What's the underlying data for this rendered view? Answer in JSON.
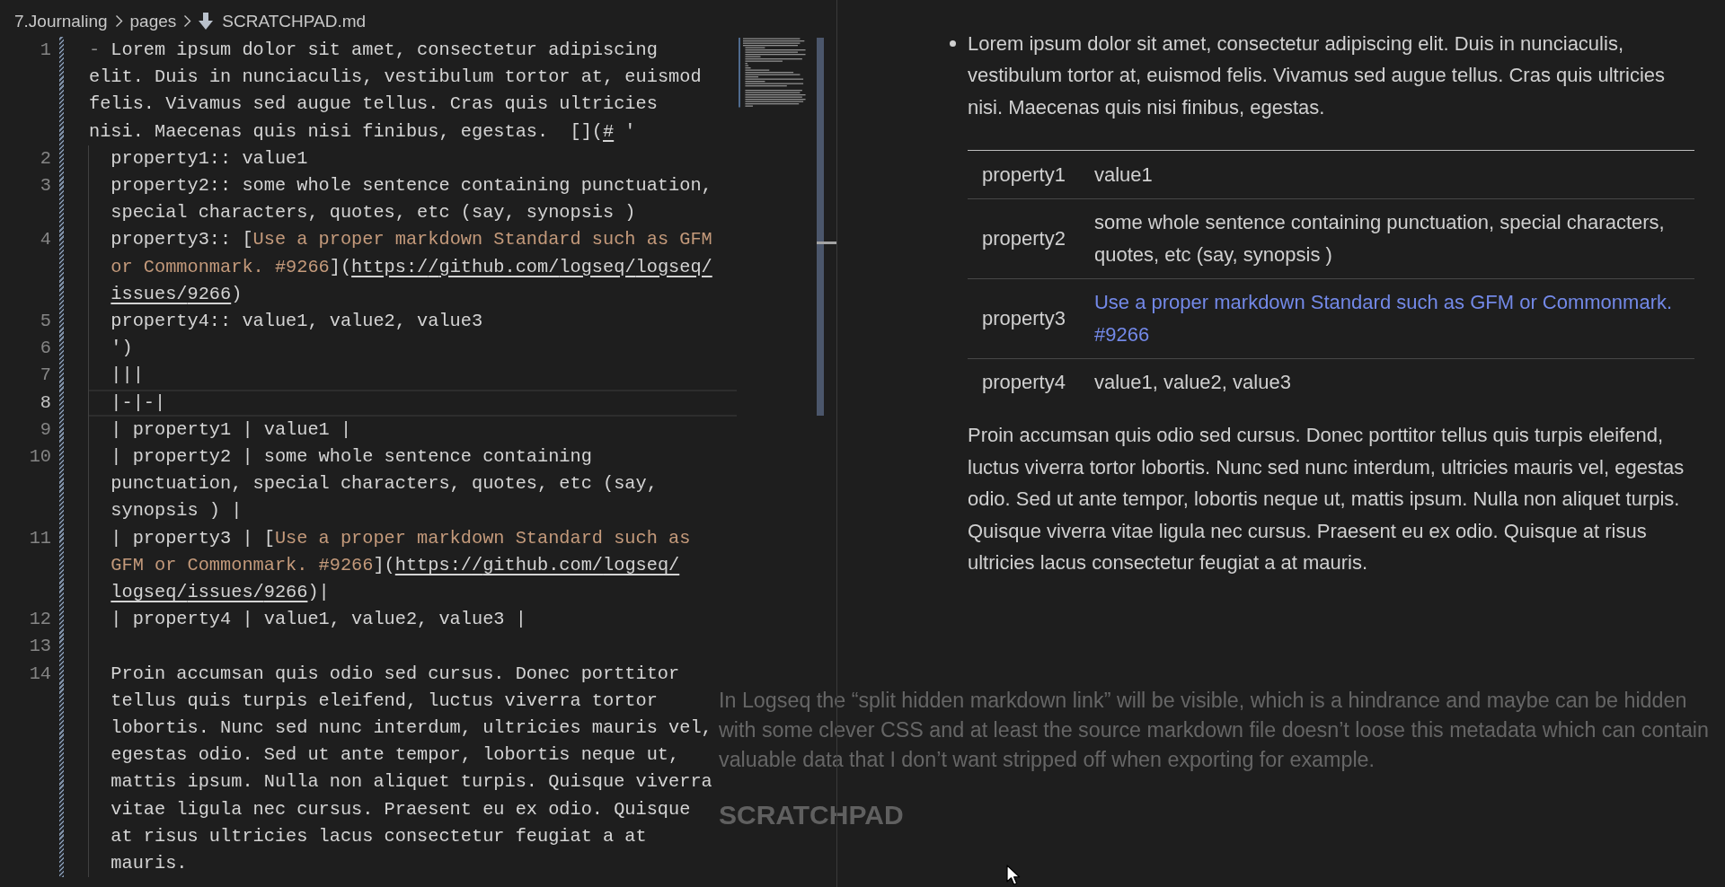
{
  "breadcrumb": [
    {
      "label": "7.Journaling",
      "kind": "folder"
    },
    {
      "label": "pages",
      "kind": "folder"
    },
    {
      "label": "SCRATCHPAD.md",
      "kind": "file"
    }
  ],
  "editor": {
    "lines": [
      {
        "number": "1",
        "indented": false,
        "cursor_line": false,
        "segments": [
          {
            "kind": "marker",
            "text": "-"
          },
          {
            "kind": "text",
            "text": " Lorem ipsum dolor sit amet, consectetur adipiscing elit. Duis in nunciaculis, vestibulum tortor at, euismod felis. Vivamus sed augue tellus. Cras quis ultricies nisi. Maecenas quis nisi finibus, egestas.  []("
          },
          {
            "kind": "url",
            "text": "#"
          },
          {
            "kind": "text",
            "text": " '"
          }
        ]
      },
      {
        "number": "2",
        "indented": true,
        "cursor_line": false,
        "segments": [
          {
            "kind": "text",
            "text": "property1:: value1"
          }
        ]
      },
      {
        "number": "3",
        "indented": true,
        "cursor_line": false,
        "segments": [
          {
            "kind": "text",
            "text": "property2:: some whole sentence containing punctuation, special characters, quotes, etc (say, synopsis )"
          }
        ]
      },
      {
        "number": "4",
        "indented": true,
        "cursor_line": false,
        "segments": [
          {
            "kind": "text",
            "text": "property3:: ["
          },
          {
            "kind": "link_text",
            "text": "Use a proper markdown Standard such as GFM or Commonmark. #9266"
          },
          {
            "kind": "text",
            "text": "]("
          },
          {
            "kind": "url",
            "text": "https://github.com/logseq/logseq/issues/9266"
          },
          {
            "kind": "text",
            "text": ")"
          }
        ]
      },
      {
        "number": "5",
        "indented": true,
        "cursor_line": false,
        "segments": [
          {
            "kind": "text",
            "text": "property4:: value1, value2, value3"
          }
        ]
      },
      {
        "number": "6",
        "indented": true,
        "cursor_line": false,
        "segments": [
          {
            "kind": "text",
            "text": "')"
          }
        ]
      },
      {
        "number": "7",
        "indented": true,
        "cursor_line": false,
        "segments": [
          {
            "kind": "text",
            "text": "|||"
          }
        ]
      },
      {
        "number": "8",
        "indented": true,
        "cursor_line": true,
        "segments": [
          {
            "kind": "text",
            "text": "|-|-|"
          }
        ]
      },
      {
        "number": "9",
        "indented": true,
        "cursor_line": false,
        "segments": [
          {
            "kind": "text",
            "text": "| property1 | value1 |"
          }
        ]
      },
      {
        "number": "10",
        "indented": true,
        "cursor_line": false,
        "segments": [
          {
            "kind": "text",
            "text": "| property2 | some whole sentence containing punctuation, special characters, quotes, etc (say, synopsis ) |"
          }
        ]
      },
      {
        "number": "11",
        "indented": true,
        "cursor_line": false,
        "segments": [
          {
            "kind": "text",
            "text": "| property3 | ["
          },
          {
            "kind": "link_text",
            "text": "Use a proper markdown Standard such as GFM or Commonmark. #9266"
          },
          {
            "kind": "text",
            "text": "]("
          },
          {
            "kind": "url",
            "text": "https://github.com/logseq/logseq/issues/9266"
          },
          {
            "kind": "text",
            "text": ")|"
          }
        ]
      },
      {
        "number": "12",
        "indented": true,
        "cursor_line": false,
        "segments": [
          {
            "kind": "text",
            "text": "| property4 | value1, value2, value3 |"
          }
        ]
      },
      {
        "number": "13",
        "indented": true,
        "cursor_line": false
      },
      {
        "number": "14",
        "indented": true,
        "cursor_line": false,
        "segments": [
          {
            "kind": "text",
            "text": "Proin accumsan quis odio sed cursus. Donec porttitor tellus quis turpis eleifend, luctus viverra tortor lobortis. Nunc sed nunc interdum, ultricies mauris vel, egestas odio. Sed ut ante tempor, lobortis neque ut, mattis ipsum. Nulla non aliquet turpis. Quisque viverra vitae ligula nec cursus. Praesent eu ex odio. Quisque at risus ultricies lacus consectetur feugiat a at mauris."
          }
        ]
      }
    ]
  },
  "preview": {
    "items": [
      {
        "text": "Lorem ipsum dolor sit amet, consectetur adipiscing elit. Duis in nunciaculis, vestibulum tortor at, euismod felis. Vivamus sed augue tellus. Cras quis ultricies nisi. Maecenas quis nisi finibus, egestas.",
        "table": {
          "rows": [
            {
              "cells": [
                {
                  "kind": "text",
                  "text": "property1"
                },
                {
                  "kind": "text",
                  "text": "value1"
                }
              ]
            },
            {
              "cells": [
                {
                  "kind": "text",
                  "text": "property2"
                },
                {
                  "kind": "text",
                  "text": "some whole sentence containing punctuation, special characters, quotes, etc (say, synopsis )"
                }
              ]
            },
            {
              "cells": [
                {
                  "kind": "text",
                  "text": "property3"
                },
                {
                  "kind": "link",
                  "text": "Use a proper markdown Standard such as GFM or Commonmark. #9266"
                }
              ]
            },
            {
              "cells": [
                {
                  "kind": "text",
                  "text": "property4"
                },
                {
                  "kind": "text",
                  "text": "value1, value2, value3"
                }
              ]
            }
          ]
        },
        "paragraph": "Proin accumsan quis odio sed cursus. Donec porttitor tellus quis turpis eleifend, luctus viverra tortor lobortis. Nunc sed nunc interdum, ultricies mauris vel, egestas odio. Sed ut ante tempor, lobortis neque ut, mattis ipsum. Nulla non aliquet turpis. Quisque viverra vitae ligula nec cursus. Praesent eu ex odio. Quisque at risus ultricies lacus consectetur feugiat a at mauris."
      }
    ]
  },
  "faded_background": {
    "paragraph": "In Logseq the “split hidden markdown link” will be visible, which is a hindrance and maybe can be hidden with some clever CSS and at least the source markdown file doesn’t loose this metadata which can contain valuable data that I don’t want stripped off when exporting for example.",
    "heading": "SCRATCHPAD"
  }
}
